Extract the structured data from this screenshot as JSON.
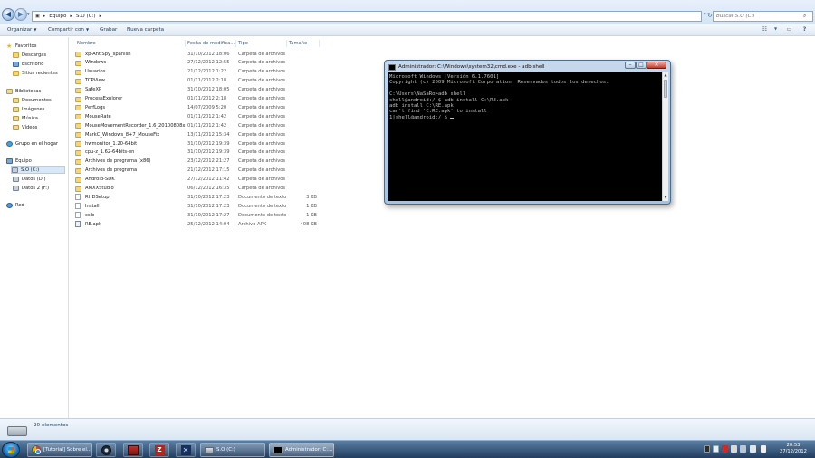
{
  "address_bar": {
    "crumbs": [
      "Equipo",
      "S.O (C:)"
    ],
    "search_placeholder": "Buscar S.O (C:)"
  },
  "command_bar": {
    "organize": "Organizar",
    "share": "Compartir con",
    "burn": "Grabar",
    "new_folder": "Nueva carpeta"
  },
  "columns": {
    "name": "Nombre",
    "date": "Fecha de modifica...",
    "type": "Tipo",
    "size": "Tamaño"
  },
  "nav": {
    "favorites": "Favoritos",
    "downloads": "Descargas",
    "desktop": "Escritorio",
    "recent": "Sitios recientes",
    "libraries": "Bibliotecas",
    "documents": "Documentos",
    "images": "Imágenes",
    "music": "Música",
    "videos": "Vídeos",
    "homegroup": "Grupo en el hogar",
    "computer": "Equipo",
    "drive_c": "S.O (C:)",
    "drive_d": "Datos (D:)",
    "drive_f": "Datos 2 (F:)",
    "network": "Red"
  },
  "files": [
    {
      "name": "xp-AntiSpy_spanish",
      "date": "31/10/2012 18:06",
      "type": "Carpeta de archivos",
      "size": "",
      "kind": "folder"
    },
    {
      "name": "Windows",
      "date": "27/12/2012 12:55",
      "type": "Carpeta de archivos",
      "size": "",
      "kind": "folder"
    },
    {
      "name": "Usuarios",
      "date": "21/12/2012 1:22",
      "type": "Carpeta de archivos",
      "size": "",
      "kind": "folder"
    },
    {
      "name": "TCPView",
      "date": "01/11/2012 2:18",
      "type": "Carpeta de archivos",
      "size": "",
      "kind": "folder"
    },
    {
      "name": "SafeXP",
      "date": "31/10/2012 18:05",
      "type": "Carpeta de archivos",
      "size": "",
      "kind": "folder"
    },
    {
      "name": "ProcessExplorer",
      "date": "01/11/2012 2:18",
      "type": "Carpeta de archivos",
      "size": "",
      "kind": "folder"
    },
    {
      "name": "PerfLogs",
      "date": "14/07/2009 5:20",
      "type": "Carpeta de archivos",
      "size": "",
      "kind": "folder"
    },
    {
      "name": "MouseRate",
      "date": "01/11/2012 1:42",
      "type": "Carpeta de archivos",
      "size": "",
      "kind": "folder"
    },
    {
      "name": "MouseMovementRecorder_1.6_20100808x",
      "date": "01/11/2012 1:42",
      "type": "Carpeta de archivos",
      "size": "",
      "kind": "folder"
    },
    {
      "name": "MarkC_Windows_8+7_MouseFix",
      "date": "13/11/2012 15:34",
      "type": "Carpeta de archivos",
      "size": "",
      "kind": "folder"
    },
    {
      "name": "hwmonitor_1.20-64bit",
      "date": "31/10/2012 19:39",
      "type": "Carpeta de archivos",
      "size": "",
      "kind": "folder"
    },
    {
      "name": "cpu-z_1.62-64bits-en",
      "date": "31/10/2012 19:39",
      "type": "Carpeta de archivos",
      "size": "",
      "kind": "folder"
    },
    {
      "name": "Archivos de programa (x86)",
      "date": "23/12/2012 21:27",
      "type": "Carpeta de archivos",
      "size": "",
      "kind": "folder"
    },
    {
      "name": "Archivos de programa",
      "date": "21/12/2012 17:15",
      "type": "Carpeta de archivos",
      "size": "",
      "kind": "folder"
    },
    {
      "name": "Android-SDK",
      "date": "27/12/2012 11:42",
      "type": "Carpeta de archivos",
      "size": "",
      "kind": "folder"
    },
    {
      "name": "AMXXStudio",
      "date": "06/12/2012 16:35",
      "type": "Carpeta de archivos",
      "size": "",
      "kind": "folder"
    },
    {
      "name": "RHDSetup",
      "date": "31/10/2012 17:23",
      "type": "Documento de texto",
      "size": "3 KB",
      "kind": "file"
    },
    {
      "name": "Install",
      "date": "31/10/2012 17:23",
      "type": "Documento de texto",
      "size": "1 KB",
      "kind": "file"
    },
    {
      "name": "cslb",
      "date": "31/10/2012 17:27",
      "type": "Documento de texto",
      "size": "1 KB",
      "kind": "file"
    },
    {
      "name": "RE.apk",
      "date": "25/12/2012 14:04",
      "type": "Archivo APK",
      "size": "408 KB",
      "kind": "apk"
    }
  ],
  "details": {
    "count": "20 elementos"
  },
  "console": {
    "title": "Administrador: C:\\Windows\\system32\\cmd.exe - adb  shell",
    "lines": [
      "Microsoft Windows [Versión 6.1.7601]",
      "Copyright (c) 2009 Microsoft Corporation. Reservados todos los derechos.",
      "",
      "C:\\Users\\NaSaRo>adb shell",
      "shell@android:/ $ adb install C:\\RE.apk",
      "adb install C:\\RE.apk",
      "can't find 'C:RE.apk' to install",
      "1|shell@android:/ $ "
    ]
  },
  "taskbar": {
    "chrome_label": "[Tutorial] Sobre el...",
    "explorer_label": "S.O (C:)",
    "cmd_label": "Administrador: C:...",
    "time": "20:53",
    "date": "27/12/2012"
  }
}
